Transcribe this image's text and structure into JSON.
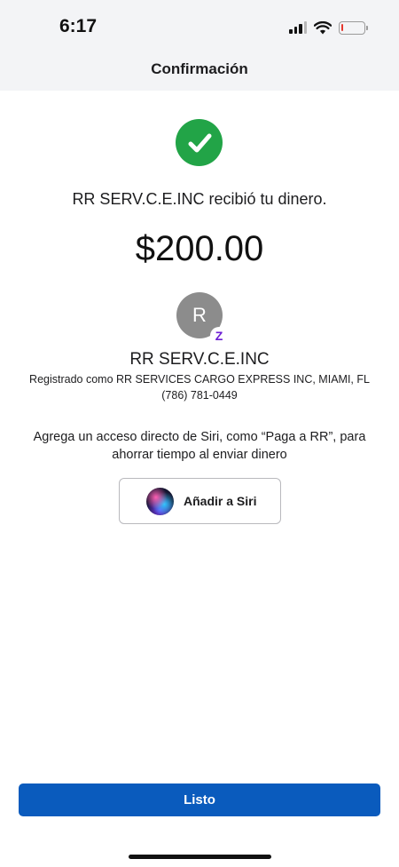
{
  "status_bar": {
    "time": "6:17",
    "battery_level": 0.1,
    "battery_color": "#e5372d"
  },
  "header": {
    "title": "Confirmación"
  },
  "confirmation": {
    "icon": "check-circle-icon",
    "message": "RR SERV.C.E.INC recibió tu dinero.",
    "amount": "$200.00"
  },
  "recipient": {
    "avatar_initial": "R",
    "badge_icon": "zelle-icon",
    "badge_glyph": "Z",
    "name": "RR SERV.C.E.INC",
    "registered_as": "Registrado como RR SERVICES CARGO EXPRESS INC, MIAMI, FL",
    "phone": "(786) 781-0449"
  },
  "siri": {
    "hint": "Agrega un acceso directo de Siri, como “Paga a RR”, para ahorrar tiempo al enviar dinero",
    "button_label": "Añadir a Siri",
    "icon": "siri-icon"
  },
  "footer": {
    "done_label": "Listo",
    "accent_color": "#0a5bbd"
  }
}
